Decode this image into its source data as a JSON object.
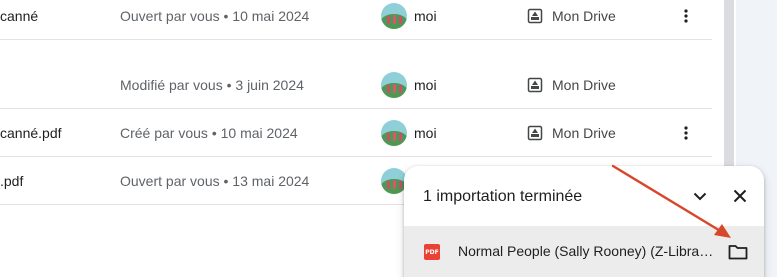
{
  "rows": [
    {
      "name": "canné",
      "activity": "Ouvert par vous • 10 mai 2024",
      "owner": "moi",
      "location": "Mon Drive"
    },
    {
      "name": "",
      "activity": "Modifié par vous • 3 juin 2024",
      "owner": "moi",
      "location": "Mon Drive"
    },
    {
      "name": "canné.pdf",
      "activity": "Créé par vous • 10 mai 2024",
      "owner": "moi",
      "location": "Mon Drive"
    },
    {
      "name": ".pdf",
      "activity": "Ouvert par vous • 13 mai 2024",
      "owner": "",
      "location": ""
    }
  ],
  "upload_panel": {
    "title": "1 importation terminée",
    "file_name": "Normal People (Sally Rooney) (Z-Library).pdf",
    "file_type_badge": "PDF"
  },
  "colors": {
    "annotation_arrow": "#d9472b",
    "pdf_icon": "#ea4335"
  }
}
